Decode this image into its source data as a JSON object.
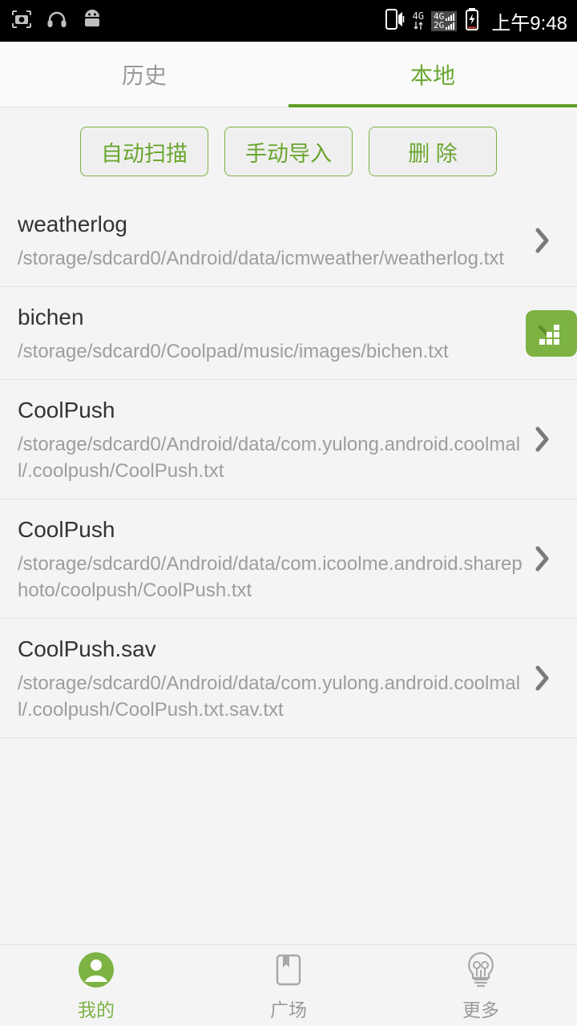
{
  "statusbar": {
    "left_icons": [
      "camera-icon",
      "headphones-icon",
      "android-robot-icon"
    ],
    "phone_sound_icon": "phone-vibrate-icon",
    "data_label": "4G",
    "sim1_label": "4G",
    "sim2_label": "2G",
    "battery_icon": "battery-charging-icon",
    "time": "上午9:48"
  },
  "tabs": [
    {
      "label": "历史",
      "active": false
    },
    {
      "label": "本地",
      "active": true
    }
  ],
  "actions": [
    {
      "label": "自动扫描"
    },
    {
      "label": "手动导入"
    },
    {
      "label": "删 除"
    }
  ],
  "list": [
    {
      "title": "weatherlog",
      "path": "/storage/sdcard0/Android/data/icmweather/weatherlog.txt",
      "accessory": "chevron-right-icon"
    },
    {
      "title": "bichen",
      "path": "/storage/sdcard0/Coolpad/music/images/bichen.txt",
      "accessory": "green-mosaic-badge"
    },
    {
      "title": "CoolPush",
      "path": "/storage/sdcard0/Android/data/com.yulong.android.coolmall/.coolpush/CoolPush.txt",
      "accessory": "chevron-right-icon"
    },
    {
      "title": "CoolPush",
      "path": "/storage/sdcard0/Android/data/com.icoolme.android.sharephoto/coolpush/CoolPush.txt",
      "accessory": "chevron-right-icon"
    },
    {
      "title": "CoolPush.sav",
      "path": "/storage/sdcard0/Android/data/com.yulong.android.coolmall/.coolpush/CoolPush.txt.sav.txt",
      "accessory": "chevron-right-icon"
    }
  ],
  "bottomnav": [
    {
      "label": "我的",
      "icon": "person-circle-icon",
      "active": true
    },
    {
      "label": "广场",
      "icon": "bookmark-square-icon",
      "active": false
    },
    {
      "label": "更多",
      "icon": "lightbulb-icon",
      "active": false
    }
  ],
  "colors": {
    "accent_green": "#7cb342",
    "tab_active_green": "#69a832",
    "underline_green": "#5f9c20",
    "page_bg": "#f4f4f4",
    "title_text": "#333333",
    "path_text": "#9d9d9d",
    "status_bar_bg": "#000000"
  }
}
